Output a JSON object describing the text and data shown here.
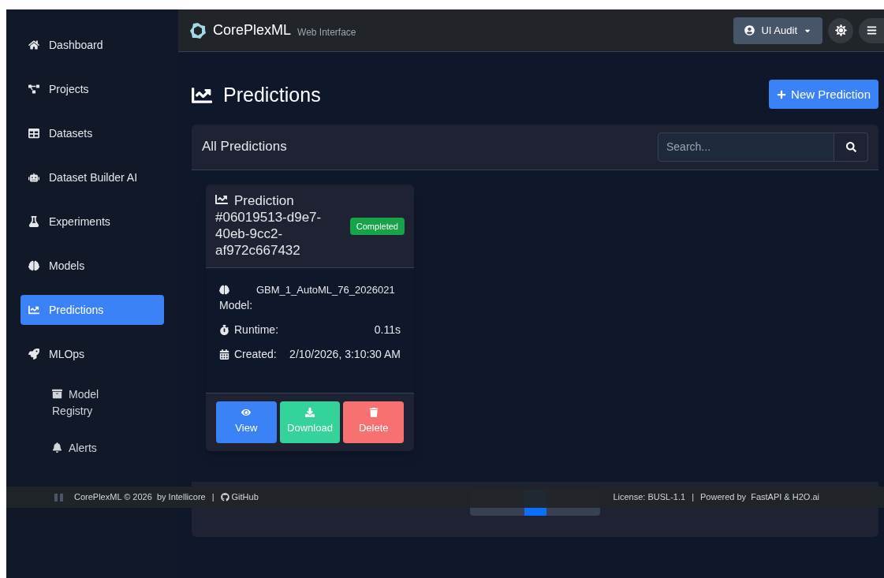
{
  "sidebar": {
    "items": [
      {
        "label": "Dashboard",
        "selected": false
      },
      {
        "label": "Projects",
        "selected": false
      },
      {
        "label": "Datasets",
        "selected": false
      },
      {
        "label": "Dataset Builder AI",
        "selected": false
      },
      {
        "label": "Experiments",
        "selected": false
      },
      {
        "label": "Models",
        "selected": false
      },
      {
        "label": "Predictions",
        "selected": true
      },
      {
        "label": "MLOps",
        "selected": false,
        "children": [
          {
            "label": "Model Registry",
            "selected": false
          },
          {
            "label": "Alerts",
            "selected": false
          }
        ]
      }
    ]
  },
  "header": {
    "brand": "CorePlexML",
    "subtitle": "Web Interface",
    "user_menu": "UI Audit"
  },
  "page": {
    "title": "Predictions",
    "new_button": "New Prediction"
  },
  "panel": {
    "title": "All Predictions",
    "search": {
      "placeholder": "Search..."
    }
  },
  "predictions": [
    {
      "title": "Prediction #06019513-d9e7-40eb-9cc2-af972c667432",
      "status": "Completed",
      "fields": [
        {
          "label": "Model:",
          "value": "GBM_1_AutoML_76_2026021"
        },
        {
          "label": "Runtime:",
          "value": "0.11s"
        },
        {
          "label": "Created:",
          "value": "2/10/2026, 3:10:30 AM"
        }
      ],
      "actions": [
        {
          "kind": "view",
          "label": "View"
        },
        {
          "kind": "download",
          "label": "Download"
        },
        {
          "kind": "delete",
          "label": "Delete"
        }
      ]
    }
  ],
  "footer": {
    "copyright": "CorePlexML © 2026  by Intellicore",
    "separator_1": "|",
    "github": "GitHub",
    "license": "License: BUSL-1.1",
    "separator_2": "|",
    "powered": "Powered by  FastAPI & H2O.ai"
  }
}
